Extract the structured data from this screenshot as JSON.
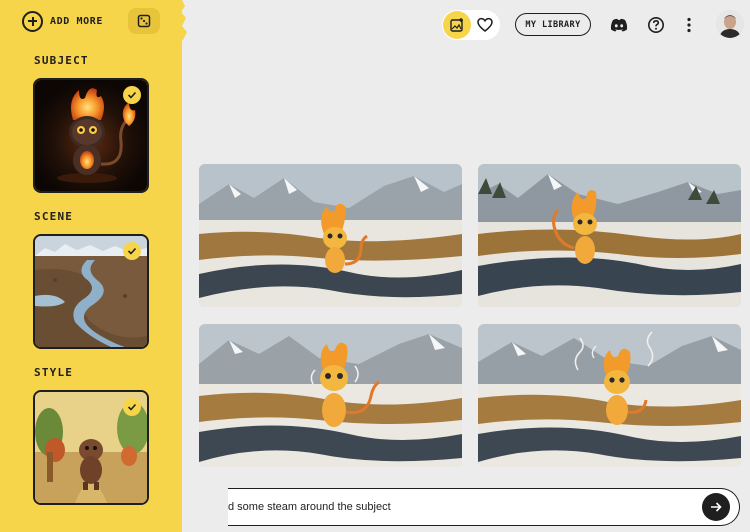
{
  "sidebar": {
    "add_more_label": "ADD MORE",
    "sections": [
      {
        "label": "SUBJECT",
        "selected": true
      },
      {
        "label": "SCENE",
        "selected": true
      },
      {
        "label": "STYLE",
        "selected": true
      }
    ]
  },
  "header": {
    "my_library_label": "MY LIBRARY",
    "icons": [
      "add-image-icon",
      "heart-icon",
      "discord-icon",
      "help-icon",
      "more-vert-icon"
    ]
  },
  "results": [
    {
      "alt": "generated-image-1"
    },
    {
      "alt": "generated-image-2"
    },
    {
      "alt": "generated-image-3"
    },
    {
      "alt": "generated-image-4"
    }
  ],
  "prompt": {
    "value": "d some steam around the subject"
  },
  "colors": {
    "accent": "#f7d54a",
    "background": "#ececec",
    "dark": "#1f1f1f"
  }
}
